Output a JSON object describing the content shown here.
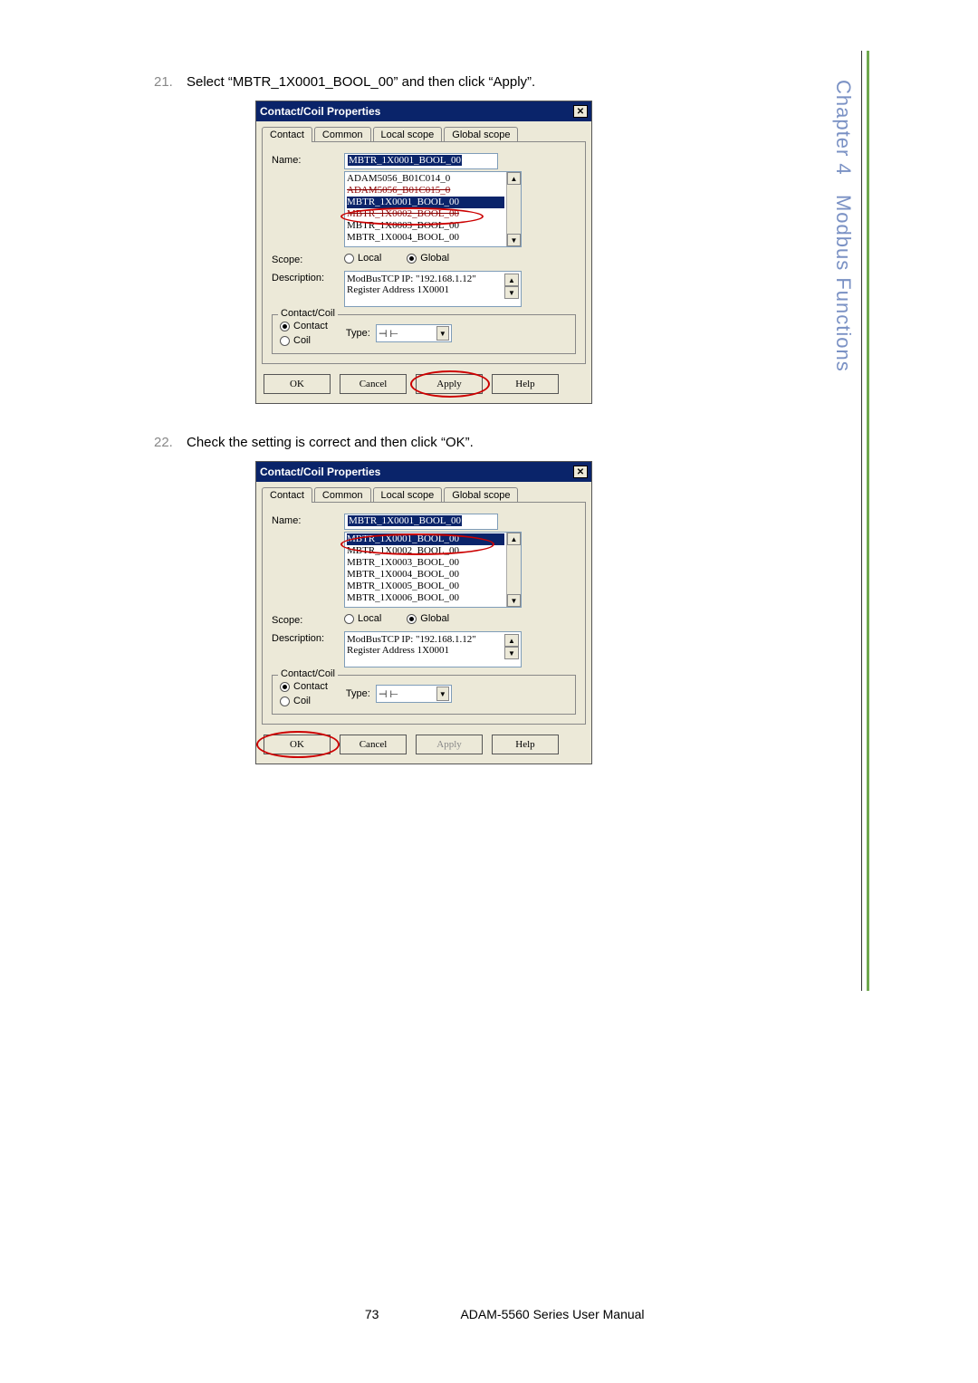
{
  "sidebar": {
    "chapter": "Chapter 4",
    "title": "Modbus Functions"
  },
  "steps": [
    {
      "num": "21.",
      "text": "Select “MBTR_1X0001_BOOL_00” and then click “Apply”."
    },
    {
      "num": "22.",
      "text": "Check the setting is correct and then click “OK”."
    }
  ],
  "dialog": {
    "title": "Contact/Coil Properties",
    "tabs": [
      "Contact",
      "Common",
      "Local scope",
      "Global scope"
    ],
    "labels": {
      "name": "Name:",
      "scope": "Scope:",
      "desc": "Description:",
      "cc": "Contact/Coil",
      "contact": "Contact",
      "coil": "Coil",
      "type": "Type:"
    },
    "scope": {
      "local": "Local",
      "global": "Global"
    },
    "buttons": {
      "ok": "OK",
      "cancel": "Cancel",
      "apply": "Apply",
      "help": "Help"
    },
    "type_value": "⊣ ⊢",
    "desc_lines": [
      "ModBusTCP IP: \"192.168.1.12\"",
      "Register Address 1X0001"
    ]
  },
  "d1": {
    "name_value": "MBTR_1X0001_BOOL_00",
    "list": [
      {
        "t": "ADAM5056_B01C014_0"
      },
      {
        "t": "ADAM5056_B01C015_0",
        "struck": true
      },
      {
        "t": "MBTR_1X0001_BOOL_00",
        "hi": true
      },
      {
        "t": "MBTR_1X0002_BOOL_00",
        "struck": true
      },
      {
        "t": "MBTR_1X0003_BOOL_00"
      },
      {
        "t": "MBTR_1X0004_BOOL_00"
      }
    ]
  },
  "d2": {
    "name_value": "MBTR_1X0001_BOOL_00",
    "list": [
      {
        "t": "MBTR_1X0001_BOOL_00",
        "hi": true
      },
      {
        "t": "MBTR_1X0002_BOOL_00"
      },
      {
        "t": "MBTR_1X0003_BOOL_00"
      },
      {
        "t": "MBTR_1X0004_BOOL_00"
      },
      {
        "t": "MBTR_1X0005_BOOL_00"
      },
      {
        "t": "MBTR_1X0006_BOOL_00"
      }
    ]
  },
  "footer": {
    "page": "73",
    "manual": "ADAM-5560 Series User Manual"
  }
}
